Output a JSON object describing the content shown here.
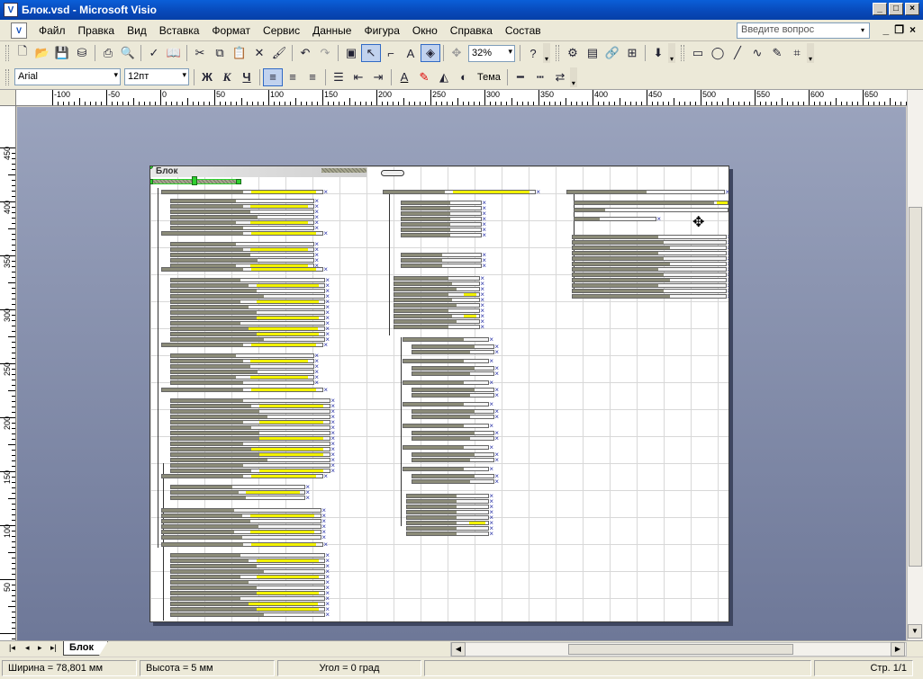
{
  "window": {
    "title": "Блок.vsd - Microsoft Visio",
    "minimize": "_",
    "maximize": "□",
    "close": "×"
  },
  "menu": {
    "items": [
      "Файл",
      "Правка",
      "Вид",
      "Вставка",
      "Формат",
      "Сервис",
      "Данные",
      "Фигура",
      "Окно",
      "Справка",
      "Состав"
    ],
    "ask_placeholder": "Введите вопрос",
    "mdi_min": "_",
    "mdi_restore": "❐",
    "mdi_close": "×"
  },
  "toolbar": {
    "zoom": "32%",
    "font": "Arial",
    "size": "12пт",
    "bold": "Ж",
    "italic": "К",
    "underline": "Ч",
    "theme": "Тема"
  },
  "ruler": {
    "top_labels": [
      "-100",
      "-50",
      "0",
      "50",
      "100",
      "150",
      "200",
      "250",
      "300",
      "350",
      "400",
      "450",
      "500",
      "550",
      "600",
      "650"
    ],
    "left_labels": [
      "450",
      "400",
      "350",
      "300",
      "250",
      "200",
      "150",
      "100",
      "50",
      "0"
    ]
  },
  "page": {
    "pool_title": "Блок"
  },
  "tabs": {
    "nav": [
      "|◂",
      "◂",
      "▸",
      "▸|"
    ],
    "active": "Блок"
  },
  "status": {
    "width": "Ширина = 78,801 мм",
    "height": "Высота = 5 мм",
    "angle": "Угол = 0 град",
    "page": "Стр. 1/1"
  },
  "colors": {
    "titlebar": "#0848b8",
    "canvas": "#7a84a2",
    "highlight": "#f2f200"
  }
}
